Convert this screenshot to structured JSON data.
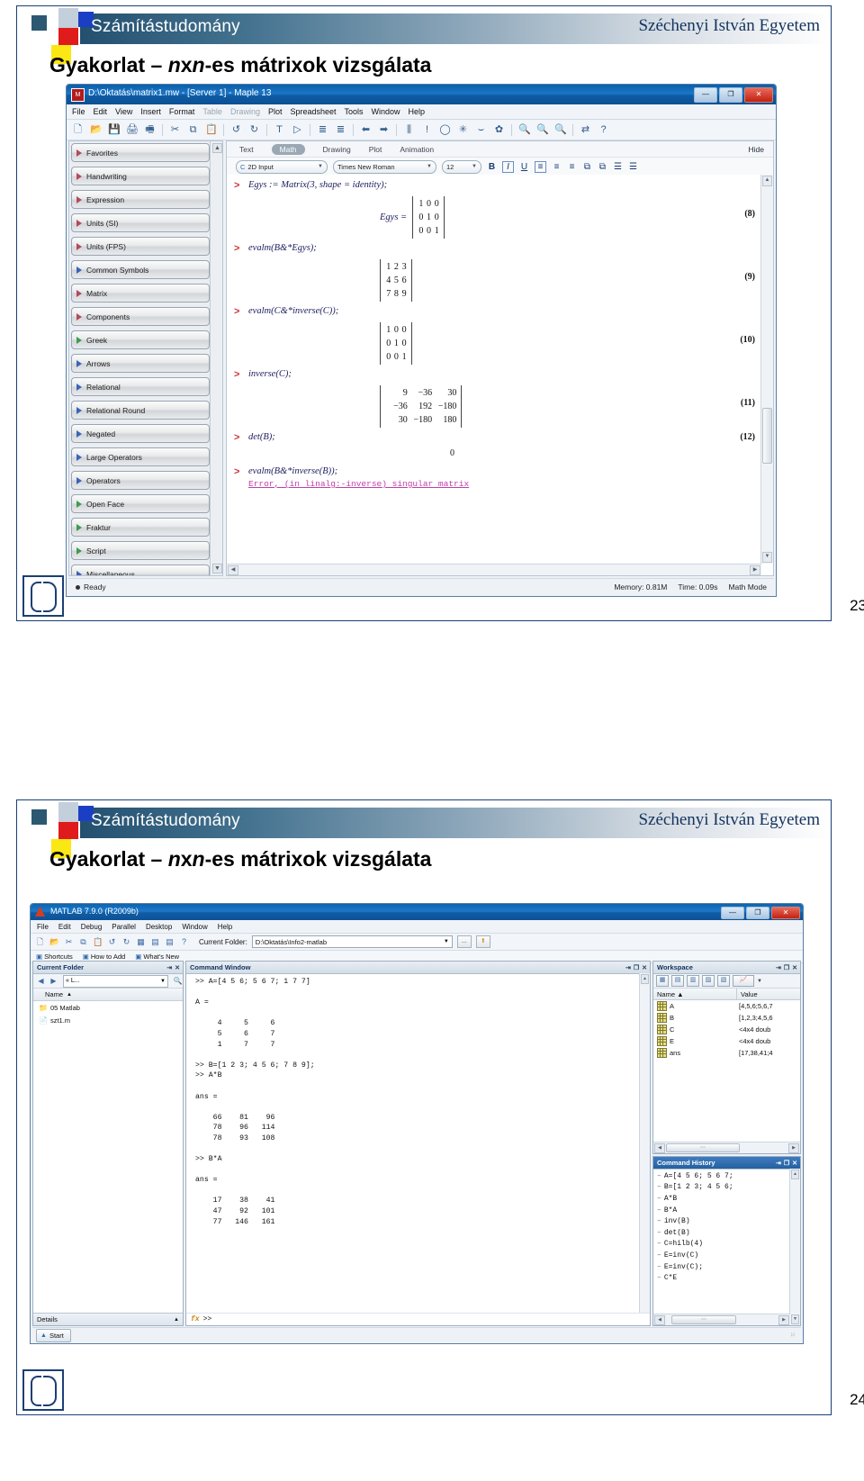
{
  "slides": [
    {
      "banner_title": "Számítástudomány",
      "banner_university": "Széchenyi István Egyetem",
      "title_pre": "Gyakorlat – ",
      "title_em": "n",
      "title_mid": "x",
      "title_em2": "n",
      "title_post": "-es mátrixok vizsgálata",
      "page_number": "23"
    },
    {
      "banner_title": "Számítástudomány",
      "banner_university": "Széchenyi István Egyetem",
      "title_pre": "Gyakorlat – ",
      "title_em": "n",
      "title_mid": "x",
      "title_em2": "n",
      "title_post": "-es mátrixok vizsgálata",
      "page_number": "24"
    }
  ],
  "maple": {
    "window_title": "D:\\Oktatás\\matrix1.mw - [Server 1] - Maple 13",
    "window_buttons": {
      "minimize": "—",
      "maximize": "❐",
      "close": "✕"
    },
    "menu": [
      "File",
      "Edit",
      "View",
      "Insert",
      "Format",
      "Table",
      "Drawing",
      "Plot",
      "Spreadsheet",
      "Tools",
      "Window",
      "Help"
    ],
    "menu_dim_indexes": [
      5,
      6
    ],
    "toolbar_icons": [
      "new-document-icon",
      "open-folder-icon",
      "save-icon",
      "print-icon",
      "print-preview-icon",
      "cut-icon",
      "copy-icon",
      "paste-icon",
      "undo-icon",
      "redo-icon",
      "text-mode-icon",
      "math-mode-icon",
      "indent-icon",
      "outdent-icon",
      "back-arrow-icon",
      "forward-arrow-icon",
      "execute-all-icon",
      "execute-icon",
      "interrupt-icon",
      "debug-icon",
      "restart-icon",
      "settings-icon",
      "zoom-fit-icon",
      "zoom-in-icon",
      "zoom-out-icon",
      "swap-icon",
      "help-icon"
    ],
    "palette": [
      {
        "label": "Favorites",
        "color": "red"
      },
      {
        "label": "Handwriting",
        "color": "red"
      },
      {
        "label": "Expression",
        "color": "red"
      },
      {
        "label": "Units (SI)",
        "color": "red"
      },
      {
        "label": "Units (FPS)",
        "color": "red"
      },
      {
        "label": "Common Symbols",
        "color": "blue"
      },
      {
        "label": "Matrix",
        "color": "red"
      },
      {
        "label": "Components",
        "color": "red"
      },
      {
        "label": "Greek",
        "color": "green"
      },
      {
        "label": "Arrows",
        "color": "blue"
      },
      {
        "label": "Relational",
        "color": "blue"
      },
      {
        "label": "Relational Round",
        "color": "blue"
      },
      {
        "label": "Negated",
        "color": "blue"
      },
      {
        "label": "Large Operators",
        "color": "blue"
      },
      {
        "label": "Operators",
        "color": "blue"
      },
      {
        "label": "Open Face",
        "color": "green"
      },
      {
        "label": "Fraktur",
        "color": "green"
      },
      {
        "label": "Script",
        "color": "green"
      },
      {
        "label": "Miscellaneous",
        "color": "blue"
      }
    ],
    "ribbon_tabs": [
      "Text",
      "Math",
      "Drawing",
      "Plot",
      "Animation"
    ],
    "ribbon_active": "Math",
    "ribbon_hide": "Hide",
    "format": {
      "input_mode": "2D Input",
      "input_mode_icon": "C",
      "font_family": "Times New Roman",
      "font_size": "12",
      "bold": "B",
      "italic": "I",
      "underline": "U",
      "align_left": "align-left-icon",
      "align_center": "align-center-icon",
      "align_right": "align-right-icon",
      "list_bullets": "bullet-list-icon",
      "list_numbers": "numbered-list-icon"
    },
    "worksheet": [
      {
        "prompt": ">",
        "command": "Egys := Matrix(3, shape = identity);",
        "result_lhs": "Egys =",
        "matrix": [
          [
            "1",
            "0",
            "0"
          ],
          [
            "0",
            "1",
            "0"
          ],
          [
            "0",
            "0",
            "1"
          ]
        ],
        "label": "(8)"
      },
      {
        "prompt": ">",
        "command": "evalm(B&*Egys);",
        "result_lhs": "",
        "matrix": [
          [
            "1",
            "2",
            "3"
          ],
          [
            "4",
            "5",
            "6"
          ],
          [
            "7",
            "8",
            "9"
          ]
        ],
        "label": "(9)"
      },
      {
        "prompt": ">",
        "command": "evalm(C&*inverse(C));",
        "result_lhs": "",
        "matrix": [
          [
            "1",
            "0",
            "0"
          ],
          [
            "0",
            "1",
            "0"
          ],
          [
            "0",
            "0",
            "1"
          ]
        ],
        "label": "(10)"
      },
      {
        "prompt": ">",
        "command": "inverse(C);",
        "result_lhs": "",
        "matrix": [
          [
            "9",
            "−36",
            "30"
          ],
          [
            "−36",
            "192",
            "−180"
          ],
          [
            "30",
            "−180",
            "180"
          ]
        ],
        "label": "(11)"
      },
      {
        "prompt": ">",
        "command": "det(B);",
        "result_lhs": "",
        "scalar": "0",
        "label": "(12)"
      },
      {
        "prompt": ">",
        "command": "evalm(B&*inverse(B));",
        "error": "Error, (in linalg:-inverse) singular matrix"
      }
    ],
    "status": {
      "ready": "Ready",
      "memory": "Memory: 0.81M",
      "time": "Time: 0.09s",
      "mode": "Math Mode"
    }
  },
  "matlab": {
    "window_title": "MATLAB 7.9.0 (R2009b)",
    "window_buttons": {
      "minimize": "—",
      "maximize": "❐",
      "close": "✕"
    },
    "menu": [
      "File",
      "Edit",
      "Debug",
      "Parallel",
      "Desktop",
      "Window",
      "Help"
    ],
    "toolbar_icons": [
      "new-file-icon",
      "open-file-icon",
      "cut-icon",
      "copy-icon",
      "paste-icon",
      "undo-icon",
      "redo-icon",
      "simulink-icon",
      "guide-icon",
      "profiler-icon",
      "help-icon"
    ],
    "current_folder_label": "Current Folder:",
    "current_folder_value": "D:\\Oktatás\\Info2-matlab",
    "browse_button": "...",
    "up_button": "up-folder-icon",
    "shortcuts": [
      "Shortcuts",
      "How to Add",
      "What's New"
    ],
    "current_folder_panel": {
      "title": "Current Folder",
      "path_value": "« L...",
      "toolbar_icons": [
        "back-icon",
        "forward-icon",
        "up-icon",
        "path-dropdown-icon",
        "search-icon"
      ],
      "column_header": "Name",
      "rows": [
        {
          "icon": "folder-icon",
          "label": "05 Matlab"
        },
        {
          "icon": "file-icon",
          "label": "szt1.m"
        }
      ],
      "details": "Details"
    },
    "command_window": {
      "title": "Command Window",
      "controls": [
        "undock-icon",
        "maximize-icon",
        "close-icon"
      ],
      "text": ">> A=[4 5 6; 5 6 7; 1 7 7]\n\nA =\n\n     4     5     6\n     5     6     7\n     1     7     7\n\n>> B=[1 2 3; 4 5 6; 7 8 9];\n>> A*B\n\nans =\n\n    66    81    96\n    78    96   114\n    78    93   108\n\n>> B*A\n\nans =\n\n    17    38    41\n    47    92   101\n    77   146   161\n",
      "prompt": ">>",
      "fx": "fx"
    },
    "workspace": {
      "title": "Workspace",
      "controls": [
        "undock-icon",
        "maximize-icon",
        "close-icon"
      ],
      "toolbar_icons": [
        "new-variable-icon",
        "open-variable-icon",
        "import-data-icon",
        "save-workspace-icon",
        "delete-icon",
        "plot-selection-icon"
      ],
      "columns": [
        "Name ▲",
        "Value"
      ],
      "rows": [
        {
          "name": "A",
          "value": "[4,5,6;5,6,7"
        },
        {
          "name": "B",
          "value": "[1,2,3;4,5,6"
        },
        {
          "name": "C",
          "value": "<4x4 doub"
        },
        {
          "name": "E",
          "value": "<4x4 doub"
        },
        {
          "name": "ans",
          "value": "[17,38,41;4"
        }
      ]
    },
    "command_history": {
      "title": "Command History",
      "controls": [
        "undock-icon",
        "maximize-icon",
        "close-icon"
      ],
      "items": [
        "A=[4 5 6; 5 6 7;",
        "B=[1 2 3; 4 5 6;",
        "A*B",
        "B*A",
        "inv(B)",
        "det(B)",
        "C=hilb(4)",
        "E=inv(C)",
        "E=inv(C);",
        "C*E"
      ]
    },
    "start_button": "Start"
  }
}
